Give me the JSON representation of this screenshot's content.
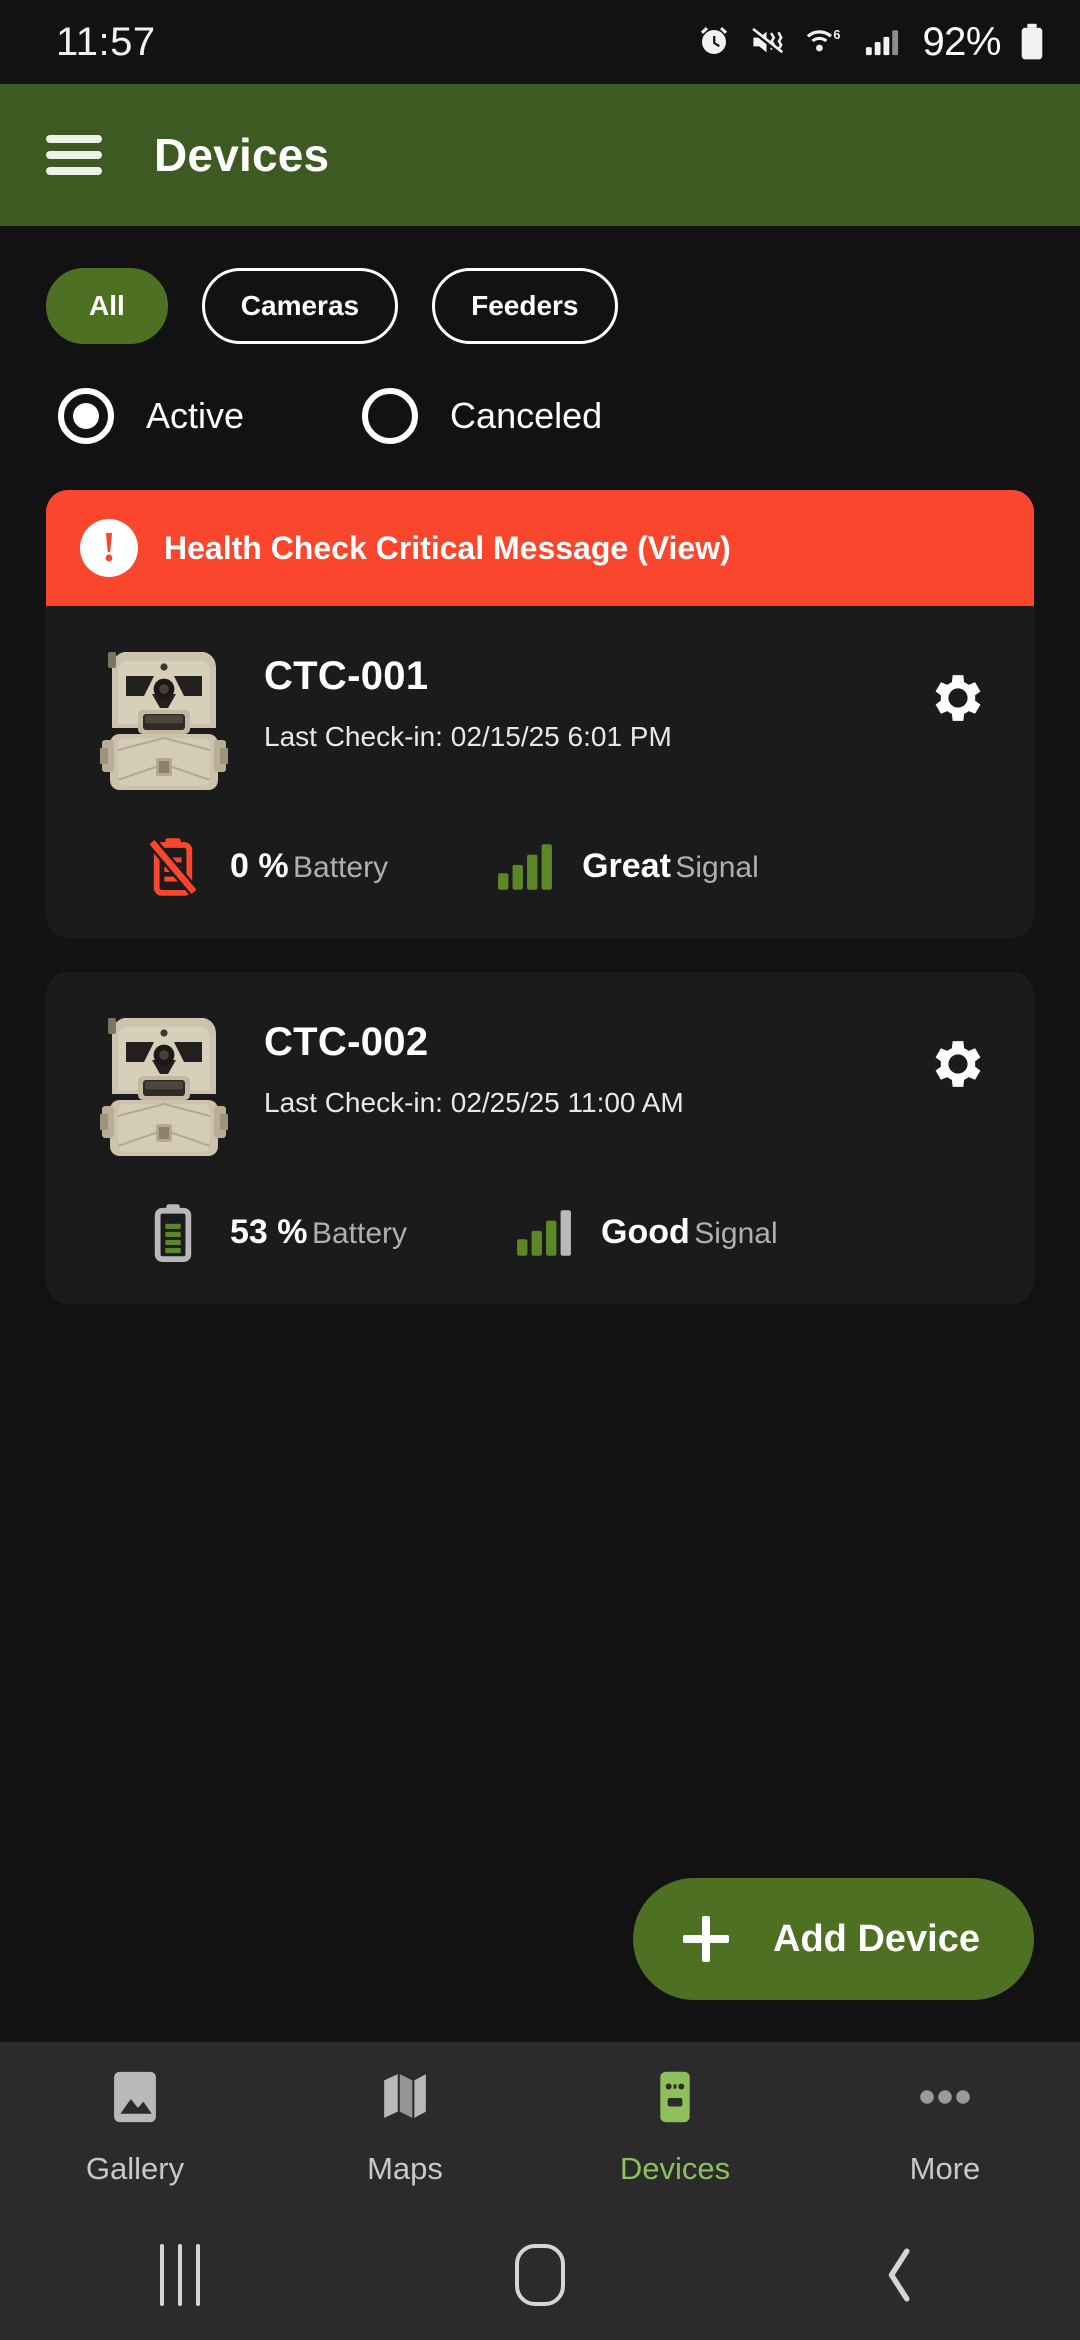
{
  "statusbar": {
    "time": "11:57",
    "battery_percent": "92%",
    "icons": [
      "alarm-icon",
      "mute-vibrate-icon",
      "wifi-6-icon",
      "cell-signal-icon",
      "battery-icon"
    ]
  },
  "appbar": {
    "title": "Devices",
    "menu_icon": "hamburger-menu-icon",
    "background_color": "#3d5a22"
  },
  "filters": {
    "chips": [
      {
        "label": "All",
        "selected": true
      },
      {
        "label": "Cameras",
        "selected": false
      },
      {
        "label": "Feeders",
        "selected": false
      }
    ],
    "status_options": [
      {
        "label": "Active",
        "selected": true
      },
      {
        "label": "Canceled",
        "selected": false
      }
    ]
  },
  "alert": {
    "text": "Health Check Critical Message (View)",
    "icon": "exclamation-icon",
    "glyph": "!",
    "color": "#f9462c"
  },
  "devices": [
    {
      "name": "CTC-001",
      "checkin": "Last Check-in: 02/15/25 6:01 PM",
      "battery_value": "0 %",
      "battery_label": "Battery",
      "battery_state": "dead",
      "signal_value": "Great",
      "signal_label": "Signal",
      "signal_bars": 4,
      "settings_icon": "gear-icon",
      "thumbnail": "trail-camera-image"
    },
    {
      "name": "CTC-002",
      "checkin": "Last Check-in: 02/25/25 11:00 AM",
      "battery_value": "53 %",
      "battery_label": "Battery",
      "battery_state": "ok",
      "signal_value": "Good",
      "signal_label": "Signal",
      "signal_bars": 3,
      "settings_icon": "gear-icon",
      "thumbnail": "trail-camera-image"
    }
  ],
  "fab": {
    "label": "Add Device",
    "icon": "plus-icon",
    "color": "#4d7023"
  },
  "bottomnav": {
    "items": [
      {
        "label": "Gallery",
        "icon": "gallery-icon",
        "active": false
      },
      {
        "label": "Maps",
        "icon": "map-icon",
        "active": false
      },
      {
        "label": "Devices",
        "icon": "device-camera-icon",
        "active": true
      },
      {
        "label": "More",
        "icon": "more-dots-icon",
        "active": false
      }
    ],
    "active_color": "#8fbf5a"
  },
  "sysnav": {
    "buttons": [
      "recents-icon",
      "home-icon",
      "back-icon"
    ]
  }
}
